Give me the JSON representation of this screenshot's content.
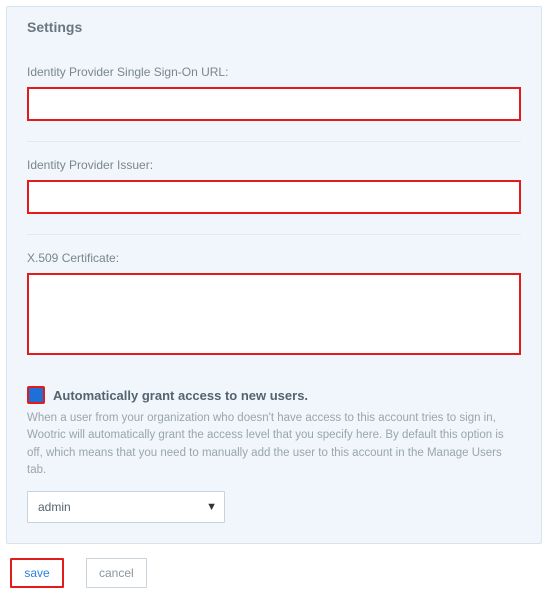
{
  "panel": {
    "title": "Settings"
  },
  "fields": {
    "sso_url": {
      "label": "Identity Provider Single Sign-On URL:",
      "value": ""
    },
    "issuer": {
      "label": "Identity Provider Issuer:",
      "value": ""
    },
    "cert": {
      "label": "X.509 Certificate:",
      "value": ""
    }
  },
  "auto_grant": {
    "label": "Automatically grant access to new users.",
    "checked": true,
    "help": "When a user from your organization who doesn't have access to this account tries to sign in, Wootric will automatically grant the access level that you specify here. By default this option is off, which means that you need to manually add the user to this account in the Manage Users tab.",
    "selected": "admin",
    "options": [
      "admin"
    ]
  },
  "buttons": {
    "save": "save",
    "cancel": "cancel"
  },
  "colors": {
    "highlight": "#e41b1b",
    "accent": "#1e6fd6"
  }
}
